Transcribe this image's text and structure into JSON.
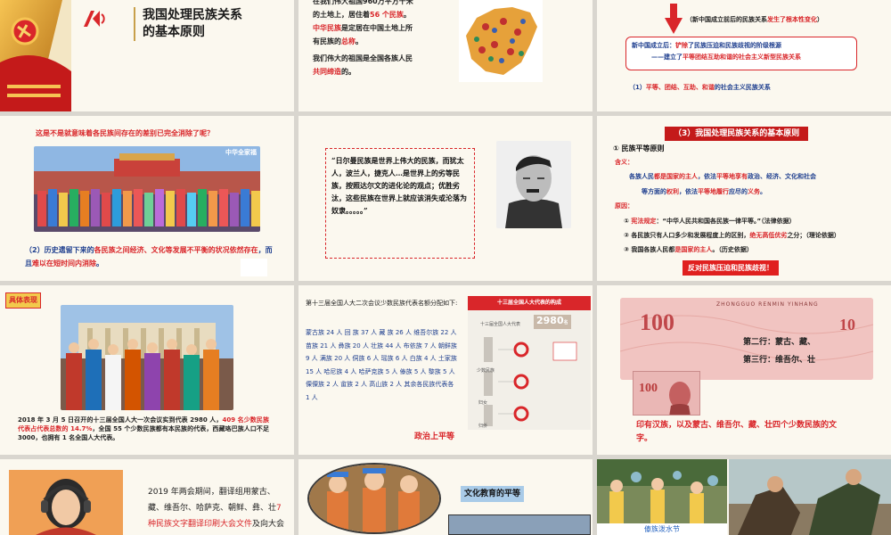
{
  "t1": {
    "title_l1": "我国处理民族关系",
    "title_l2": "的基本原则"
  },
  "t2": {
    "l1": "在我们伟大祖国960万平方千米",
    "l2": "的土地上，居住着",
    "l2_red": "56 个民族",
    "l2_end": "。",
    "l3_red": "中华民族",
    "l3": "是定居在中国土地上所",
    "l4": "有民族的",
    "l4_red": "总称",
    "l4_end": "。",
    "l5": "我们伟大的祖国是全国各族人民",
    "l6_red": "共同缔造",
    "l6": "的。"
  },
  "t3": {
    "note_pre": "（新中国成立前后的民族关系",
    "note_red": "发生了根本性变化",
    "note_end": "）",
    "box_l1_head": "新中国成立后：",
    "box_l1_red": "铲除",
    "box_l1": "了民族压迫和民族歧视的阶级根源",
    "box_l2_pre": "——建立了",
    "box_l2_red": "平等团结互助和谐的社会主义新型民族关系",
    "item1_pre": "（1）",
    "item1_red": "平等、团结、互助、和谐",
    "item1": "的社会主义民族关系"
  },
  "t4": {
    "question": "这是不是就意味着各民族间存在的差别已完全消除了呢？",
    "photo_caption": "中华全家福",
    "p1_pre": "（2）历史遗留下来的",
    "p1_red": "各民族之间经济、文化等发展不平衡的状况依然存在",
    "p1_mid": "，而且",
    "p1_red2": "难以在短时间内消除",
    "p1_end": "。"
  },
  "t5": {
    "quote": "“日尔曼民族是世界上伟大的民族，而犹太人，波兰人，捷克人…是世界上的劣等民族，按照达尔文的进化论的观点；优胜劣汰，这些民族在世界上就应该消失或沦落为奴隶。。。。。”"
  },
  "t6": {
    "header": "（3）我国处理民族关系的基本原则",
    "h1": "① 民族平等原则",
    "meaning_label": "含义：",
    "m1_pre": "各族人民",
    "m1_red": "都是国家的主人",
    "m1_mid": "，依法",
    "m1_red2": "平等地享有",
    "m1_end": "政治、经济、文化和社会",
    "m2_pre": "等方面的",
    "m2_red": "权利",
    "m2_mid": "，依法",
    "m2_red2": "平等地履行",
    "m2_mid2": "应尽的",
    "m2_red3": "义务",
    "m2_end": "。",
    "reason_label": "原因：",
    "r1_pre": "① ",
    "r1_red": "宪法规定",
    "r1": "：“中华人民共和国各民族一律平等。”（法律依据）",
    "r2": "② 各民族只有人口多少和发展程度上的区别，",
    "r2_red": "绝无高低优劣",
    "r2_end": "之分；（理论依据）",
    "r3": "③ 我国各族人民都",
    "r3_red": "是国家的主人",
    "r3_end": "。（历史依据）",
    "badge": "反对民族压迫和民族歧视！"
  },
  "t7": {
    "tag": "具体表现",
    "cap_pre": "2018 年 3 月 5 日召开的十三届全国人大一次会议实到代表 2980 人，",
    "cap_red": "409 名少数民族代表占代表总数的 14.7%",
    "cap_end": "，全国 55 个少数民族都有本民族的代表，西藏珞巴族人口不足 3000，也拥有 1 名全国人大代表。"
  },
  "t8": {
    "intro": "第十三届全国人大二次会议少数民族代表名额分配如下:",
    "quota": "蒙古族 24 人  回 族 37 人  藏 族 26 人  维吾尔族 22 人  苗族 21 人 彝族 20 人  壮族 44 人  布依族 7 人  朝鲜族 9 人 满族 20 人  侗族 6 人  瑶族 6 人 白族 4 人  土家族 15 人 哈尼族 4 人  哈萨克族 5 人  傣族 5 人  黎族 5 人  傈僳族 2 人  畲族 2 人  高山族 2 人  其余各民族代表各 1 人",
    "badge": "政治上平等",
    "chart_title": "十三届全国人大代表的构成",
    "chart_total_label": "十三届全国人大代表",
    "chart_total": "2980",
    "chart_unit": "名",
    "chart_rows": [
      "少数民族",
      "妇女",
      "归侨"
    ]
  },
  "t9": {
    "bank": "ZHONGGUO RENMIN YINHANG",
    "denom": "100",
    "line2": "第二行：蒙古、藏、",
    "line3": "第三行：维吾尔、壮",
    "bottom": "印有汉族，以及蒙古、维吾尔、藏、壮四个少数民族的文字。"
  },
  "t10": {
    "text_pre": "2019 年两会期间，翻译组用蒙古、藏、维吾尔、哈萨克、朝鲜、彝、壮",
    "text_red": "7 种民族文字翻译印刷大会文件",
    "text_end": "及向大会"
  },
  "t11": {
    "badge": "文化教育的平等"
  },
  "t12": {
    "caption": "傣族泼水节"
  }
}
